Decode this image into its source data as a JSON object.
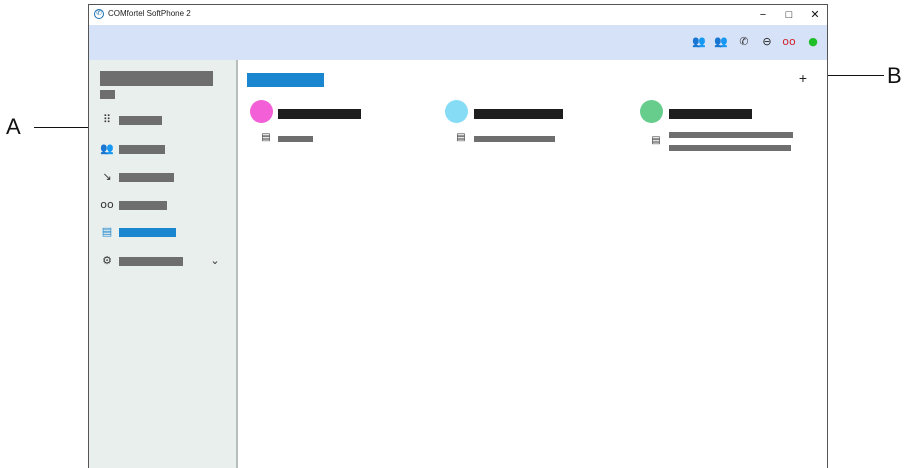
{
  "window": {
    "title": "COMfortel SoftPhone 2",
    "logo_icon": "softphone-logo-icon",
    "controls": {
      "minimize": "−",
      "maximize": "□",
      "close": "✕"
    }
  },
  "toolbar": {
    "icons": [
      {
        "name": "contacts-icon",
        "glyph": "👥",
        "color": "#333333"
      },
      {
        "name": "presence-contacts-icon",
        "glyph": "👥",
        "color": "#22a03c"
      },
      {
        "name": "call-forward-icon",
        "glyph": "✆",
        "color": "#333333"
      },
      {
        "name": "do-not-disturb-icon",
        "glyph": "⊖",
        "color": "#222222"
      },
      {
        "name": "voicemail-icon",
        "glyph": "oo",
        "color": "#d0222a"
      },
      {
        "name": "status-online-icon",
        "glyph": "●",
        "color": "#1fbf2a"
      }
    ]
  },
  "sidebar": {
    "nav_items": [
      {
        "name": "nav-dialpad",
        "icon": "dialpad-icon",
        "glyph": "⠿"
      },
      {
        "name": "nav-contacts",
        "icon": "contacts-icon",
        "glyph": "👥"
      },
      {
        "name": "nav-call-history",
        "icon": "call-history-icon",
        "glyph": "↘"
      },
      {
        "name": "nav-voicemail",
        "icon": "voicemail-icon",
        "glyph": "oo"
      },
      {
        "name": "nav-messages",
        "icon": "message-icon",
        "glyph": "▤",
        "active": true
      },
      {
        "name": "nav-settings",
        "icon": "gear-icon",
        "glyph": "⚙",
        "chevron": "⌄"
      }
    ]
  },
  "main": {
    "add_button": "+",
    "conversations": [
      {
        "avatar_color": "#f25fd6",
        "message_icon": "▤"
      },
      {
        "avatar_color": "#86dcf5",
        "message_icon": "▤"
      },
      {
        "avatar_color": "#67cd8d",
        "message_icon": "▤"
      }
    ]
  },
  "callouts": {
    "a": "A",
    "b": "B"
  },
  "colors": {
    "accent": "#1a86d0",
    "toolbar_bg": "#d6e2f8",
    "sidebar_bg": "#e9efed"
  }
}
